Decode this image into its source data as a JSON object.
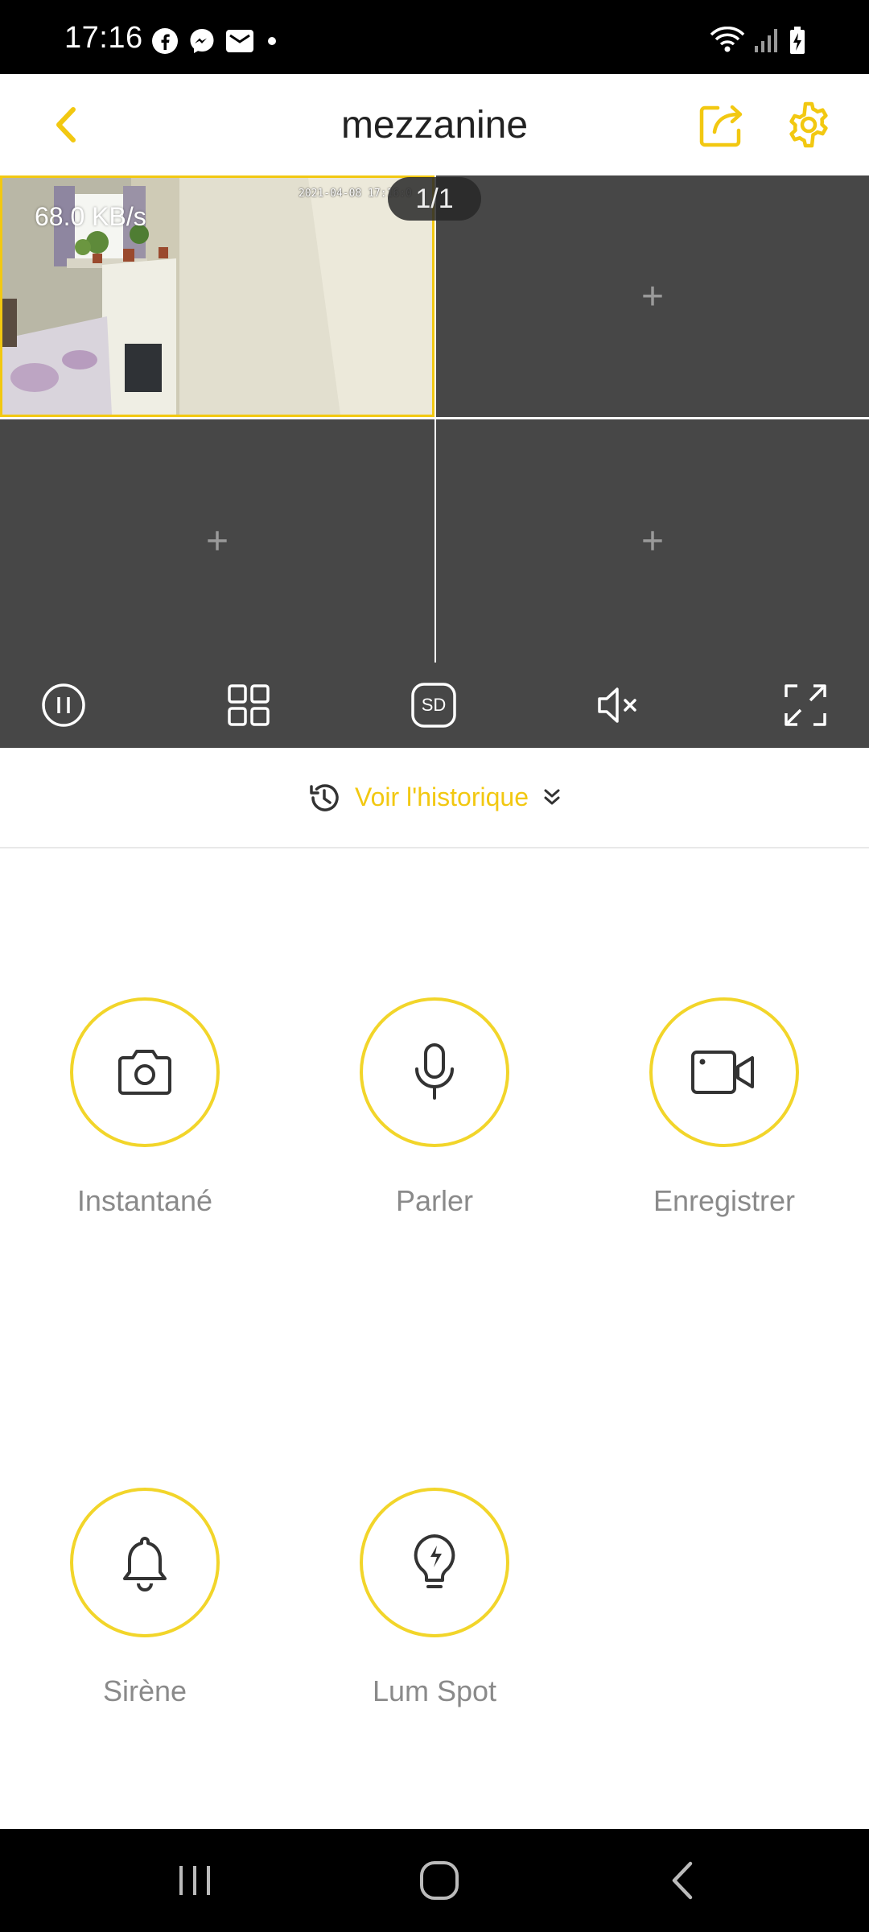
{
  "status_bar": {
    "time": "17:16",
    "left_icons": [
      "facebook-icon",
      "messenger-icon",
      "mail-icon",
      "dot-icon"
    ],
    "right_icons": [
      "wifi-icon",
      "signal-icon",
      "battery-charging-icon"
    ]
  },
  "header": {
    "title": "mezzanine",
    "back_icon": "chevron-left-icon",
    "share_icon": "share-icon",
    "settings_icon": "gear-icon",
    "accent_color": "#f2c811"
  },
  "video": {
    "speed": "68.0 KB/s",
    "timestamp": "2021-04-08 17:16:0",
    "page_indicator": "1/1",
    "empty_slot_symbol": "+"
  },
  "toolbar": {
    "items": [
      "pause-icon",
      "grid-layout-icon",
      "sd-quality-icon",
      "mute-icon",
      "fullscreen-icon"
    ],
    "sd_label": "SD"
  },
  "history": {
    "label": "Voir l'historique"
  },
  "actions": [
    {
      "label": "Instantané",
      "icon": "camera-icon"
    },
    {
      "label": "Parler",
      "icon": "microphone-icon"
    },
    {
      "label": "Enregistrer",
      "icon": "video-record-icon"
    },
    {
      "label": "Sirène",
      "icon": "bell-icon"
    },
    {
      "label": "Lum Spot",
      "icon": "lightbulb-icon"
    }
  ],
  "navbar": {
    "items": [
      "recent-apps-icon",
      "home-icon",
      "back-icon"
    ]
  }
}
